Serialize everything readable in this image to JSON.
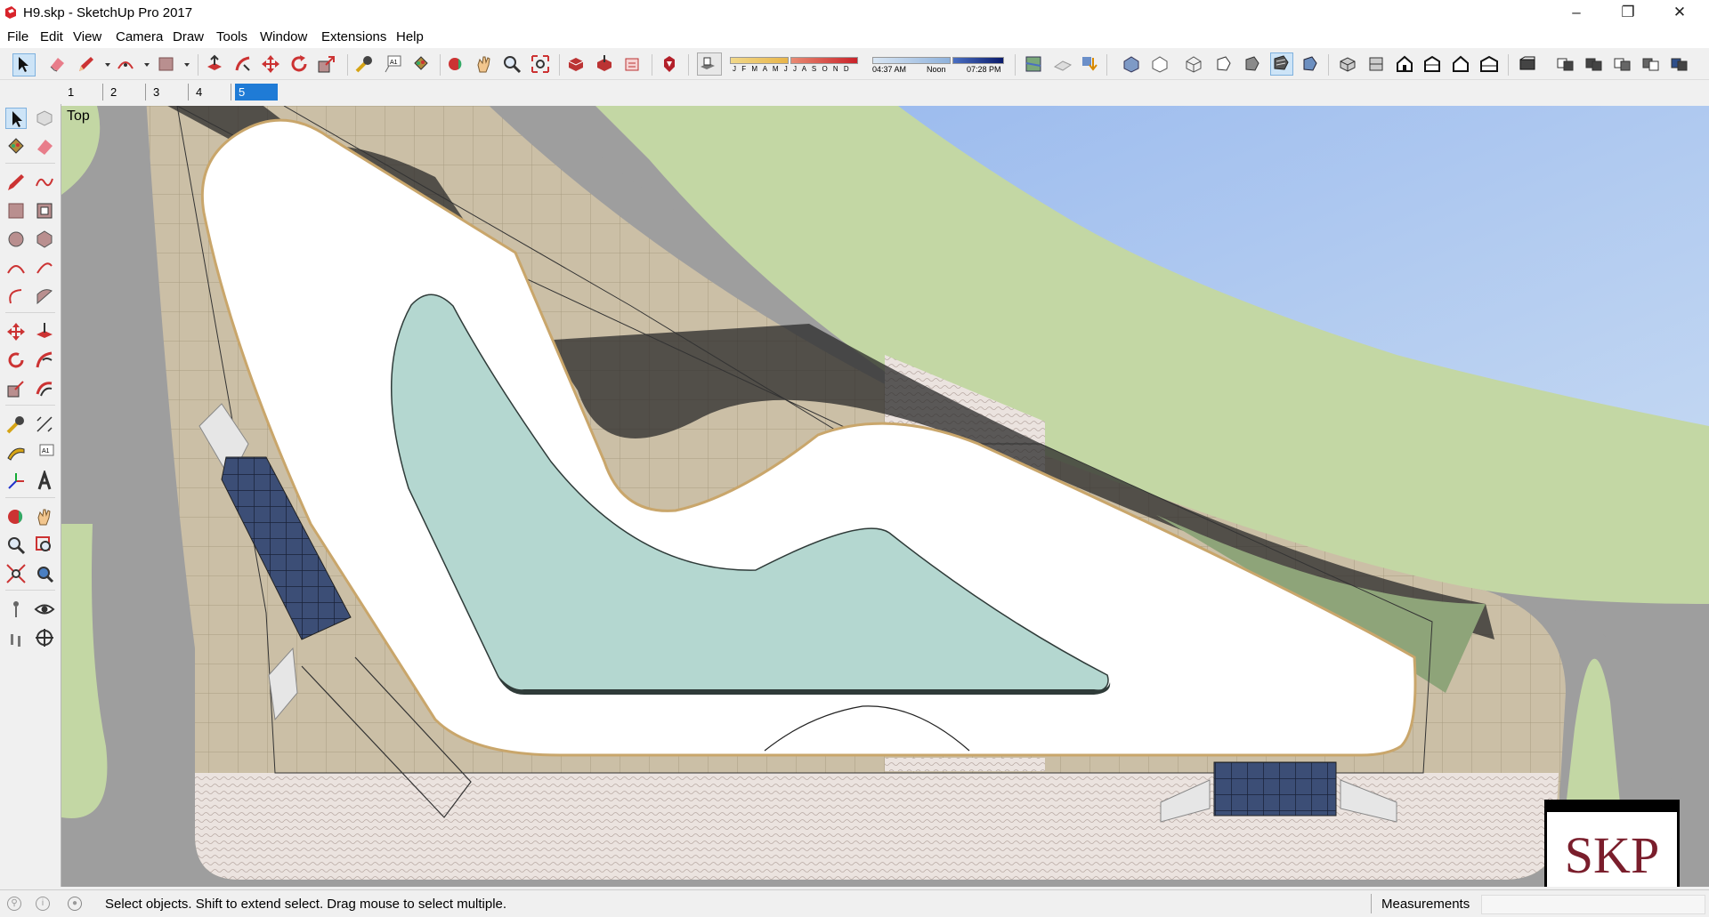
{
  "window": {
    "title": "H9.skp - SketchUp Pro 2017",
    "minimize": "–",
    "restore": "❐",
    "close": "✕"
  },
  "menu": [
    "File",
    "Edit",
    "View",
    "Camera",
    "Draw",
    "Tools",
    "Window",
    "Extensions",
    "Help"
  ],
  "shadow_settings": {
    "months": "J F M A M J J A S O N D",
    "sunrise": "04:37 AM",
    "noon": "Noon",
    "sunset": "07:28 PM"
  },
  "scenes": [
    "1",
    "2",
    "3",
    "4",
    "5"
  ],
  "active_scene": "5",
  "viewport": {
    "view_name": "Top",
    "watermark": "SKP"
  },
  "status": {
    "hint": "Select objects. Shift to extend select. Drag mouse to select multiple.",
    "measurements_label": "Measurements",
    "measurements_value": ""
  },
  "colors": {
    "road": "#9e9e9e",
    "lawn": "#c3d7a4",
    "water": "#a9c4ea",
    "paving": "#cbbfa6",
    "pool": "#b4d7d0",
    "plaza": "#ffffff",
    "logo": "#7a1e2c"
  }
}
